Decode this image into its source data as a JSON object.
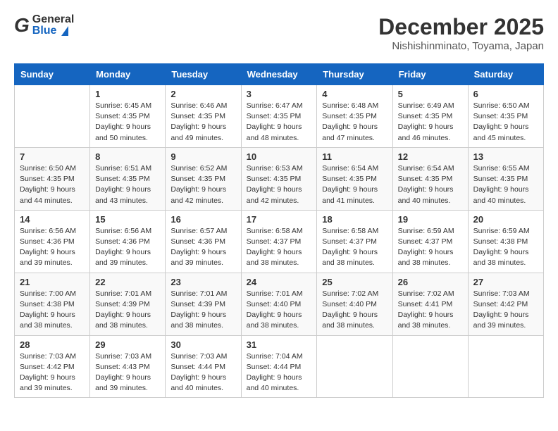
{
  "header": {
    "logo_general": "General",
    "logo_blue": "Blue",
    "month": "December 2025",
    "location": "Nishishinminato, Toyama, Japan"
  },
  "days_of_week": [
    "Sunday",
    "Monday",
    "Tuesday",
    "Wednesday",
    "Thursday",
    "Friday",
    "Saturday"
  ],
  "weeks": [
    [
      {
        "day": "",
        "info": ""
      },
      {
        "day": "1",
        "info": "Sunrise: 6:45 AM\nSunset: 4:35 PM\nDaylight: 9 hours\nand 50 minutes."
      },
      {
        "day": "2",
        "info": "Sunrise: 6:46 AM\nSunset: 4:35 PM\nDaylight: 9 hours\nand 49 minutes."
      },
      {
        "day": "3",
        "info": "Sunrise: 6:47 AM\nSunset: 4:35 PM\nDaylight: 9 hours\nand 48 minutes."
      },
      {
        "day": "4",
        "info": "Sunrise: 6:48 AM\nSunset: 4:35 PM\nDaylight: 9 hours\nand 47 minutes."
      },
      {
        "day": "5",
        "info": "Sunrise: 6:49 AM\nSunset: 4:35 PM\nDaylight: 9 hours\nand 46 minutes."
      },
      {
        "day": "6",
        "info": "Sunrise: 6:50 AM\nSunset: 4:35 PM\nDaylight: 9 hours\nand 45 minutes."
      }
    ],
    [
      {
        "day": "7",
        "info": "Sunrise: 6:50 AM\nSunset: 4:35 PM\nDaylight: 9 hours\nand 44 minutes."
      },
      {
        "day": "8",
        "info": "Sunrise: 6:51 AM\nSunset: 4:35 PM\nDaylight: 9 hours\nand 43 minutes."
      },
      {
        "day": "9",
        "info": "Sunrise: 6:52 AM\nSunset: 4:35 PM\nDaylight: 9 hours\nand 42 minutes."
      },
      {
        "day": "10",
        "info": "Sunrise: 6:53 AM\nSunset: 4:35 PM\nDaylight: 9 hours\nand 42 minutes."
      },
      {
        "day": "11",
        "info": "Sunrise: 6:54 AM\nSunset: 4:35 PM\nDaylight: 9 hours\nand 41 minutes."
      },
      {
        "day": "12",
        "info": "Sunrise: 6:54 AM\nSunset: 4:35 PM\nDaylight: 9 hours\nand 40 minutes."
      },
      {
        "day": "13",
        "info": "Sunrise: 6:55 AM\nSunset: 4:35 PM\nDaylight: 9 hours\nand 40 minutes."
      }
    ],
    [
      {
        "day": "14",
        "info": "Sunrise: 6:56 AM\nSunset: 4:36 PM\nDaylight: 9 hours\nand 39 minutes."
      },
      {
        "day": "15",
        "info": "Sunrise: 6:56 AM\nSunset: 4:36 PM\nDaylight: 9 hours\nand 39 minutes."
      },
      {
        "day": "16",
        "info": "Sunrise: 6:57 AM\nSunset: 4:36 PM\nDaylight: 9 hours\nand 39 minutes."
      },
      {
        "day": "17",
        "info": "Sunrise: 6:58 AM\nSunset: 4:37 PM\nDaylight: 9 hours\nand 38 minutes."
      },
      {
        "day": "18",
        "info": "Sunrise: 6:58 AM\nSunset: 4:37 PM\nDaylight: 9 hours\nand 38 minutes."
      },
      {
        "day": "19",
        "info": "Sunrise: 6:59 AM\nSunset: 4:37 PM\nDaylight: 9 hours\nand 38 minutes."
      },
      {
        "day": "20",
        "info": "Sunrise: 6:59 AM\nSunset: 4:38 PM\nDaylight: 9 hours\nand 38 minutes."
      }
    ],
    [
      {
        "day": "21",
        "info": "Sunrise: 7:00 AM\nSunset: 4:38 PM\nDaylight: 9 hours\nand 38 minutes."
      },
      {
        "day": "22",
        "info": "Sunrise: 7:01 AM\nSunset: 4:39 PM\nDaylight: 9 hours\nand 38 minutes."
      },
      {
        "day": "23",
        "info": "Sunrise: 7:01 AM\nSunset: 4:39 PM\nDaylight: 9 hours\nand 38 minutes."
      },
      {
        "day": "24",
        "info": "Sunrise: 7:01 AM\nSunset: 4:40 PM\nDaylight: 9 hours\nand 38 minutes."
      },
      {
        "day": "25",
        "info": "Sunrise: 7:02 AM\nSunset: 4:40 PM\nDaylight: 9 hours\nand 38 minutes."
      },
      {
        "day": "26",
        "info": "Sunrise: 7:02 AM\nSunset: 4:41 PM\nDaylight: 9 hours\nand 38 minutes."
      },
      {
        "day": "27",
        "info": "Sunrise: 7:03 AM\nSunset: 4:42 PM\nDaylight: 9 hours\nand 39 minutes."
      }
    ],
    [
      {
        "day": "28",
        "info": "Sunrise: 7:03 AM\nSunset: 4:42 PM\nDaylight: 9 hours\nand 39 minutes."
      },
      {
        "day": "29",
        "info": "Sunrise: 7:03 AM\nSunset: 4:43 PM\nDaylight: 9 hours\nand 39 minutes."
      },
      {
        "day": "30",
        "info": "Sunrise: 7:03 AM\nSunset: 4:44 PM\nDaylight: 9 hours\nand 40 minutes."
      },
      {
        "day": "31",
        "info": "Sunrise: 7:04 AM\nSunset: 4:44 PM\nDaylight: 9 hours\nand 40 minutes."
      },
      {
        "day": "",
        "info": ""
      },
      {
        "day": "",
        "info": ""
      },
      {
        "day": "",
        "info": ""
      }
    ]
  ]
}
